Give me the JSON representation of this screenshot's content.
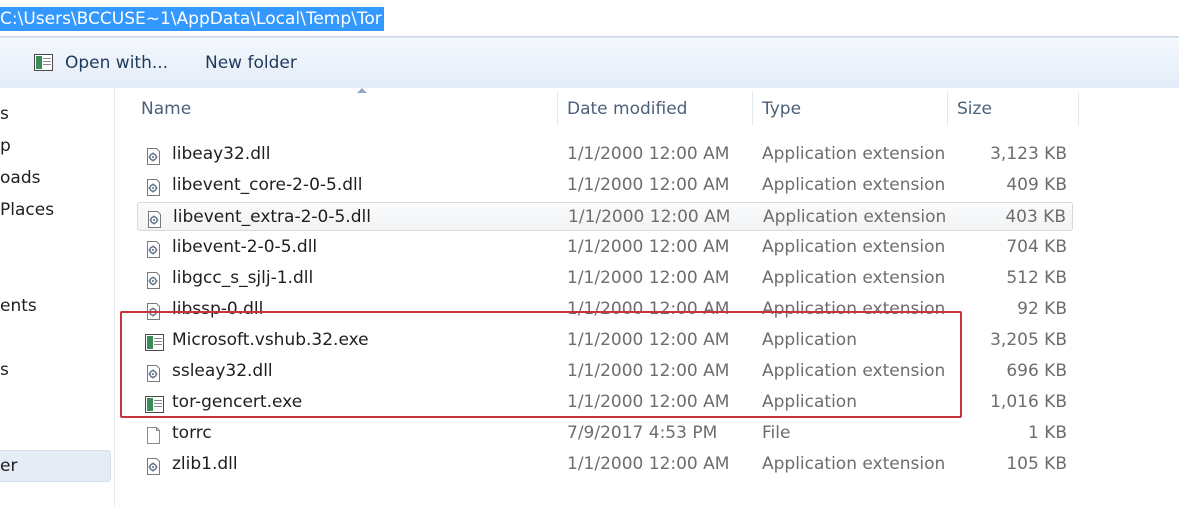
{
  "address_bar": {
    "path": "C:\\Users\\BCCUSE~1\\AppData\\Local\\Temp\\Tor"
  },
  "toolbar": {
    "open_with_label": "Open with...",
    "new_folder_label": "New folder"
  },
  "nav_pane": {
    "items": [
      "s",
      "p",
      "oads",
      " Places",
      "ents",
      "s",
      "er"
    ]
  },
  "columns": {
    "name": "Name",
    "date_modified": "Date modified",
    "type": "Type",
    "size": "Size"
  },
  "files": [
    {
      "name": "libeay32.dll",
      "date": "1/1/2000 12:00 AM",
      "type": "Application extension",
      "size": "3,123 KB",
      "icon": "dll-file-icon"
    },
    {
      "name": "libevent_core-2-0-5.dll",
      "date": "1/1/2000 12:00 AM",
      "type": "Application extension",
      "size": "409 KB",
      "icon": "dll-file-icon"
    },
    {
      "name": "libevent_extra-2-0-5.dll",
      "date": "1/1/2000 12:00 AM",
      "type": "Application extension",
      "size": "403 KB",
      "icon": "dll-file-icon"
    },
    {
      "name": "libevent-2-0-5.dll",
      "date": "1/1/2000 12:00 AM",
      "type": "Application extension",
      "size": "704 KB",
      "icon": "dll-file-icon"
    },
    {
      "name": "libgcc_s_sjlj-1.dll",
      "date": "1/1/2000 12:00 AM",
      "type": "Application extension",
      "size": "512 KB",
      "icon": "dll-file-icon"
    },
    {
      "name": "libssp-0.dll",
      "date": "1/1/2000 12:00 AM",
      "type": "Application extension",
      "size": "92 KB",
      "icon": "dll-file-icon"
    },
    {
      "name": "Microsoft.vshub.32.exe",
      "date": "1/1/2000 12:00 AM",
      "type": "Application",
      "size": "3,205 KB",
      "icon": "exe-file-icon"
    },
    {
      "name": "ssleay32.dll",
      "date": "1/1/2000 12:00 AM",
      "type": "Application extension",
      "size": "696 KB",
      "icon": "dll-file-icon"
    },
    {
      "name": "tor-gencert.exe",
      "date": "1/1/2000 12:00 AM",
      "type": "Application",
      "size": "1,016 KB",
      "icon": "exe-file-icon"
    },
    {
      "name": "torrc",
      "date": "7/9/2017 4:53 PM",
      "type": "File",
      "size": "1 KB",
      "icon": "blank-file-icon"
    },
    {
      "name": "zlib1.dll",
      "date": "1/1/2000 12:00 AM",
      "type": "Application extension",
      "size": "105 KB",
      "icon": "dll-file-icon"
    }
  ],
  "hovered_file": "libevent_extra-2-0-5.dll",
  "highlighted_files": [
    "Microsoft.vshub.32.exe",
    "ssleay32.dll",
    "tor-gencert.exe"
  ],
  "colors": {
    "selection_blue": "#3399ff",
    "highlight_red": "#c8323a",
    "toolbar_text": "#1e395b"
  }
}
